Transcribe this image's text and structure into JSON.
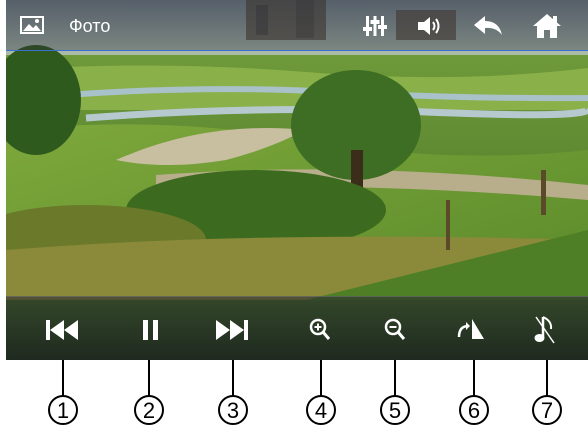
{
  "header": {
    "title": "Фото",
    "icons": [
      "image-icon",
      "equalizer-icon",
      "volume-icon",
      "back-icon",
      "home-icon"
    ]
  },
  "controls": [
    {
      "name": "previous-button",
      "icon": "skip-back-icon",
      "callout": "1"
    },
    {
      "name": "pause-button",
      "icon": "pause-icon",
      "callout": "2"
    },
    {
      "name": "next-button",
      "icon": "skip-forward-icon",
      "callout": "3"
    },
    {
      "name": "zoom-in-button",
      "icon": "zoom-in-icon",
      "callout": "4"
    },
    {
      "name": "zoom-out-button",
      "icon": "zoom-out-icon",
      "callout": "5"
    },
    {
      "name": "rotate-button",
      "icon": "rotate-icon",
      "callout": "6"
    },
    {
      "name": "music-button",
      "icon": "music-note-icon",
      "callout": "7"
    }
  ],
  "colors": {
    "header_divider": "#3a6fd0",
    "icon": "#ffffff",
    "callout": "#000000"
  }
}
